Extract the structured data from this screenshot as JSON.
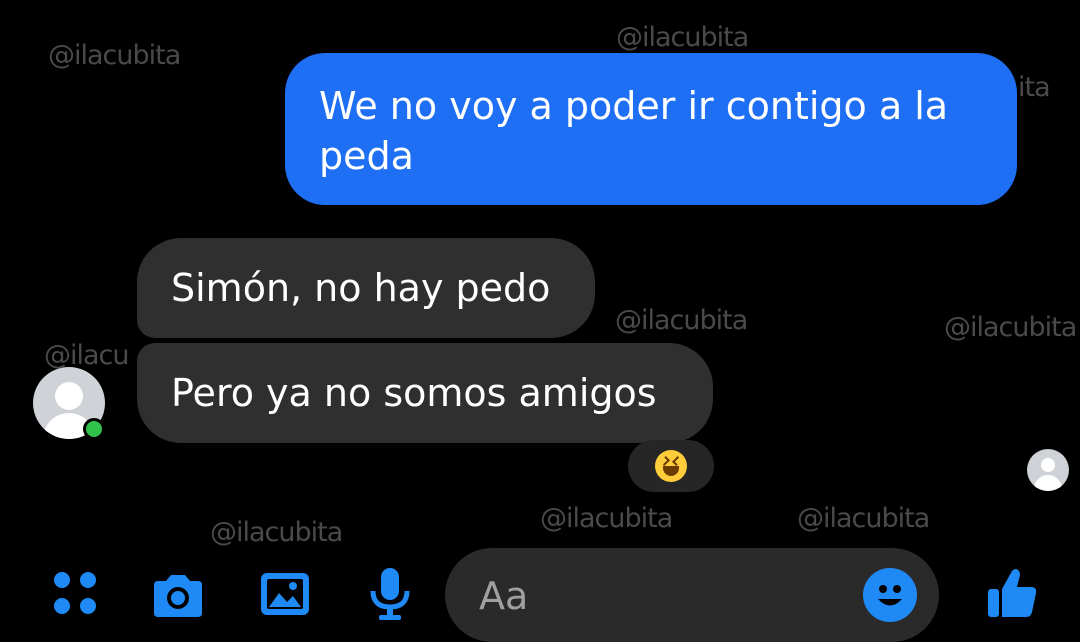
{
  "watermarks": [
    "@ilacubita",
    "@ilacubita",
    "ita",
    "@ilacubita",
    "@ilacubita",
    "@ilacu",
    "@ilacubita",
    "@ilacubita",
    "@ilacubita"
  ],
  "messages": {
    "outgoing_1": "We no voy a poder ir contigo a la peda",
    "incoming_1": "Simón, no hay pedo",
    "incoming_2": "Pero ya no somos amigos"
  },
  "reaction": {
    "icon": "laughing-emoji-icon"
  },
  "contact": {
    "online": true,
    "status_color": "#31c24c"
  },
  "composer": {
    "placeholder": "Aa"
  },
  "toolbar": {
    "icons": [
      "more-apps-icon",
      "camera-icon",
      "gallery-icon",
      "microphone-icon",
      "emoji-icon",
      "thumbs-up-icon"
    ]
  },
  "colors": {
    "accent": "#1f6ff5",
    "toolbar_icon": "#1f8af5",
    "incoming_bubble": "#2f2f2f",
    "background": "#000000"
  }
}
